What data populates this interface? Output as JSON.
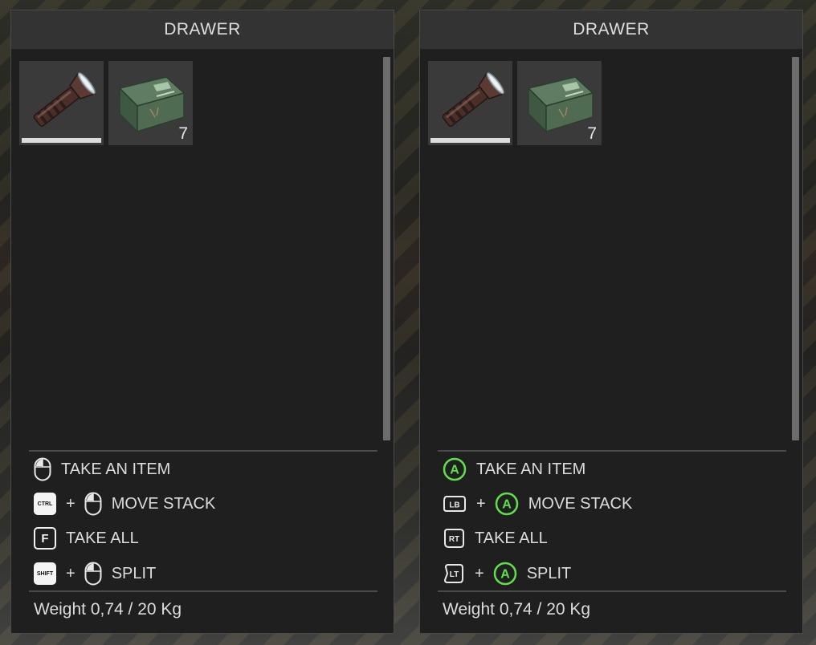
{
  "panels": [
    {
      "title": "DRAWER",
      "items": [
        {
          "name": "flashlight",
          "durability": 1.0
        },
        {
          "name": "battery-box",
          "quantity": "7"
        }
      ],
      "hints": [
        {
          "action": "TAKE AN ITEM",
          "keys": [
            "mouse-icon"
          ]
        },
        {
          "action": "MOVE STACK",
          "keys": [
            "ctrl-key-icon",
            "mouse-icon"
          ],
          "plus": "+",
          "key_text": "CTRL"
        },
        {
          "action": "TAKE ALL",
          "keys": [
            "f-key-icon"
          ],
          "key_text": "F"
        },
        {
          "action": "SPLIT",
          "keys": [
            "shift-key-icon",
            "mouse-icon"
          ],
          "plus": "+",
          "key_text": "SHIFT"
        }
      ],
      "weight": "Weight 0,74 / 20 Kg"
    },
    {
      "title": "DRAWER",
      "items": [
        {
          "name": "flashlight",
          "durability": 1.0
        },
        {
          "name": "battery-box",
          "quantity": "7"
        }
      ],
      "hints": [
        {
          "action": "TAKE AN ITEM",
          "keys": [
            "a-button-icon"
          ],
          "key_text": "A"
        },
        {
          "action": "MOVE STACK",
          "keys": [
            "lb-button-icon",
            "a-button-icon"
          ],
          "plus": "+",
          "key_text": "LB",
          "key_text2": "A"
        },
        {
          "action": "TAKE ALL",
          "keys": [
            "rt-button-icon"
          ],
          "key_text": "RT"
        },
        {
          "action": "SPLIT",
          "keys": [
            "lt-button-icon",
            "a-button-icon"
          ],
          "plus": "+",
          "key_text": "LT",
          "key_text2": "A"
        }
      ],
      "weight": "Weight 0,74 / 20 Kg"
    }
  ],
  "colors": {
    "panel_bg": "#1f1f1f",
    "header_bg": "#333333",
    "slot_bg": "#3a3a3a",
    "controller_a_green": "#5fe04a",
    "text": "#dcdcdc"
  }
}
